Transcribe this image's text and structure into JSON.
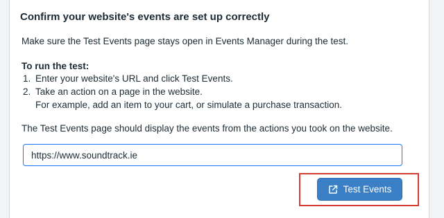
{
  "panel": {
    "heading": "Confirm your website's events are set up correctly",
    "intro": "Make sure the Test Events page stays open in Events Manager during the test.",
    "run_title": "To run the test:",
    "steps": [
      {
        "num": "1.",
        "text": "Enter your website's URL and click Test Events."
      },
      {
        "num": "2.",
        "text": "Take an action on a page in the website.",
        "sub": "For example, add an item to your cart, or simulate a purchase transaction."
      }
    ],
    "display_note": "The Test Events page should display the events from the actions you took on the website.",
    "url_input": {
      "value": "https://www.soundtrack.ie",
      "placeholder": ""
    },
    "test_button": {
      "label": "Test Events",
      "icon": "external-link-icon"
    }
  },
  "colors": {
    "button_bg": "#3b80c7",
    "input_border": "#1877f2",
    "highlight": "#d63b30"
  }
}
